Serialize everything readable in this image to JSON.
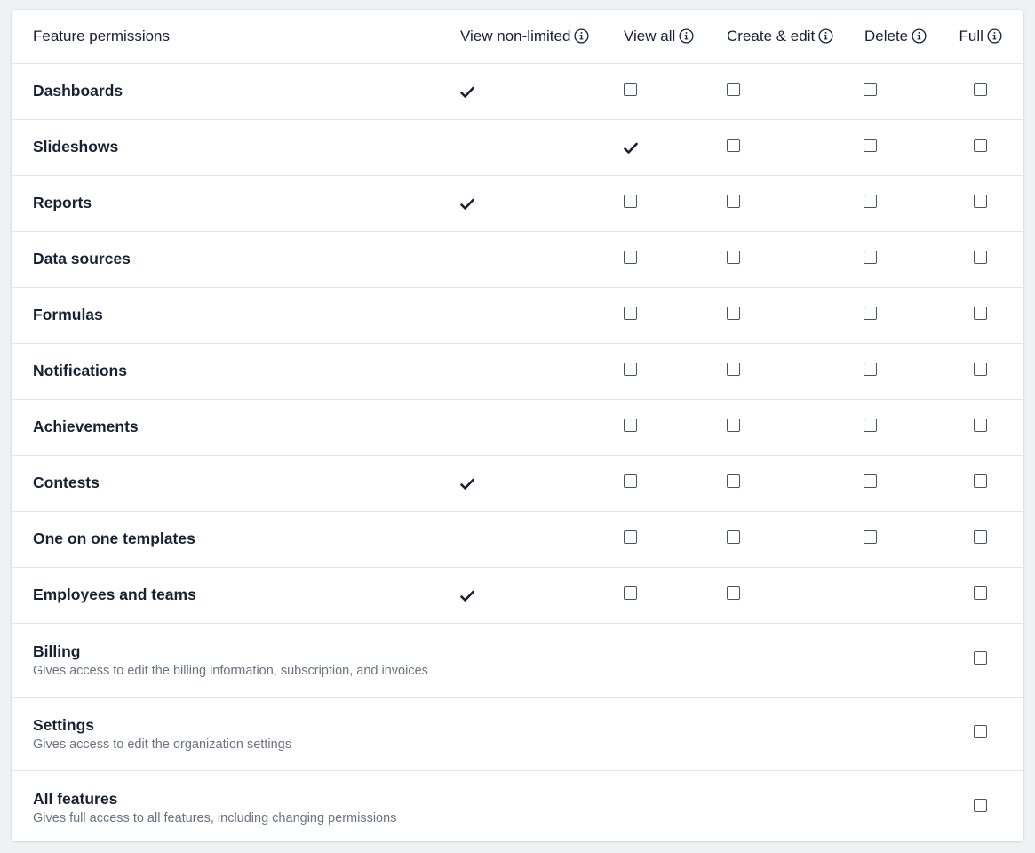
{
  "header": {
    "feature_col": "Feature permissions",
    "columns": [
      "View non-limited",
      "View all",
      "Create & edit",
      "Delete",
      "Full"
    ]
  },
  "icons": {
    "info": "info-icon",
    "check": "check-icon"
  },
  "rows": [
    {
      "title": "Dashboards",
      "desc": "",
      "cells": [
        "check",
        "box",
        "box",
        "box",
        "box"
      ]
    },
    {
      "title": "Slideshows",
      "desc": "",
      "cells": [
        "",
        "check",
        "box",
        "box",
        "box"
      ]
    },
    {
      "title": "Reports",
      "desc": "",
      "cells": [
        "check",
        "box",
        "box",
        "box",
        "box"
      ]
    },
    {
      "title": "Data sources",
      "desc": "",
      "cells": [
        "",
        "box",
        "box",
        "box",
        "box"
      ]
    },
    {
      "title": "Formulas",
      "desc": "",
      "cells": [
        "",
        "box",
        "box",
        "box",
        "box"
      ]
    },
    {
      "title": "Notifications",
      "desc": "",
      "cells": [
        "",
        "box",
        "box",
        "box",
        "box"
      ]
    },
    {
      "title": "Achievements",
      "desc": "",
      "cells": [
        "",
        "box",
        "box",
        "box",
        "box"
      ]
    },
    {
      "title": "Contests",
      "desc": "",
      "cells": [
        "check",
        "box",
        "box",
        "box",
        "box"
      ]
    },
    {
      "title": "One on one templates",
      "desc": "",
      "cells": [
        "",
        "box",
        "box",
        "box",
        "box"
      ]
    },
    {
      "title": "Employees and teams",
      "desc": "",
      "cells": [
        "check",
        "box",
        "box",
        "",
        "box"
      ]
    },
    {
      "title": "Billing",
      "desc": "Gives access to edit the billing information, subscription, and invoices",
      "cells": [
        "",
        "",
        "",
        "",
        "box"
      ]
    },
    {
      "title": "Settings",
      "desc": "Gives access to edit the organization settings",
      "cells": [
        "",
        "",
        "",
        "",
        "box"
      ]
    },
    {
      "title": "All features",
      "desc": "Gives full access to all features, including changing permissions",
      "cells": [
        "",
        "",
        "",
        "",
        "box"
      ]
    }
  ],
  "colors": {
    "background": "#f0f1f2",
    "text": "#172133",
    "muted": "#6b7280",
    "border": "#e3e5e8"
  }
}
